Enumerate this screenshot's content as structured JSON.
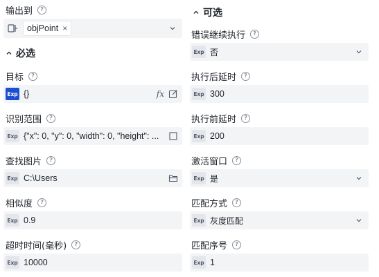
{
  "output": {
    "label": "输出到",
    "tag": "objPoint",
    "tag_remove": "×"
  },
  "required": {
    "title": "必选",
    "fields": {
      "target": {
        "label": "目标",
        "exp": "Exp",
        "value": "{}",
        "fx": "fx"
      },
      "region": {
        "label": "识别范围",
        "exp": "Exp",
        "value": "{\"x\": 0, \"y\": 0, \"width\": 0, \"height\": ..."
      },
      "image": {
        "label": "查找图片",
        "exp": "Exp",
        "value": "C:\\Users"
      },
      "similarity": {
        "label": "相似度",
        "exp": "Exp",
        "value": "0.9"
      },
      "timeout": {
        "label": "超时时间(毫秒)",
        "exp": "Exp",
        "value": "10000"
      }
    }
  },
  "optional": {
    "title": "可选",
    "fields": {
      "continue_on_error": {
        "label": "错误继续执行",
        "exp": "Exp",
        "value": "否"
      },
      "delay_after": {
        "label": "执行后延时",
        "exp": "Exp",
        "value": "300"
      },
      "delay_before": {
        "label": "执行前延时",
        "exp": "Exp",
        "value": "200"
      },
      "activate_window": {
        "label": "激活窗口",
        "exp": "Exp",
        "value": "是"
      },
      "match_mode": {
        "label": "匹配方式",
        "exp": "Exp",
        "value": "灰度匹配"
      },
      "match_index": {
        "label": "匹配序号",
        "exp": "Exp",
        "value": "1"
      }
    }
  },
  "help_glyph": "?",
  "colors": {
    "accent": "#1d4fd1",
    "field_bg": "#f3f4f6",
    "exp_bg": "#e5e6eb"
  }
}
